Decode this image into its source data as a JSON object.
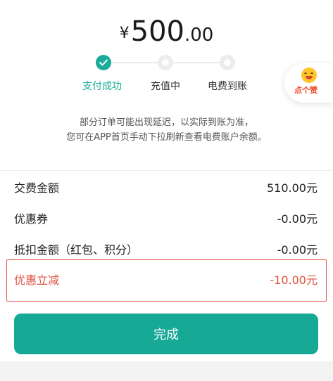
{
  "payment": {
    "currency_symbol": "¥",
    "amount_integer": "500",
    "amount_decimal": ".00"
  },
  "steps": [
    {
      "label": "支付成功",
      "state": "done"
    },
    {
      "label": "充值中",
      "state": "pending"
    },
    {
      "label": "电费到账",
      "state": "pending"
    }
  ],
  "like_badge": {
    "label": "点个赞",
    "icon": "smile-emoji-icon"
  },
  "notice": {
    "line1": "部分订单可能出现延迟，以实际到账为准，",
    "line2": "您可在APP首页手动下拉刷新查看电费账户余额。"
  },
  "details": [
    {
      "label": "交费金额",
      "value": "510.00元"
    },
    {
      "label": "优惠券",
      "value": "-0.00元"
    },
    {
      "label": "抵扣金额（红包、积分）",
      "value": "-0.00元"
    },
    {
      "label": "优惠立减",
      "value": "-10.00元"
    }
  ],
  "done_button": {
    "label": "完成"
  },
  "colors": {
    "accent": "#16a996",
    "highlight": "#e0523f",
    "pending_step": "#ececec"
  }
}
